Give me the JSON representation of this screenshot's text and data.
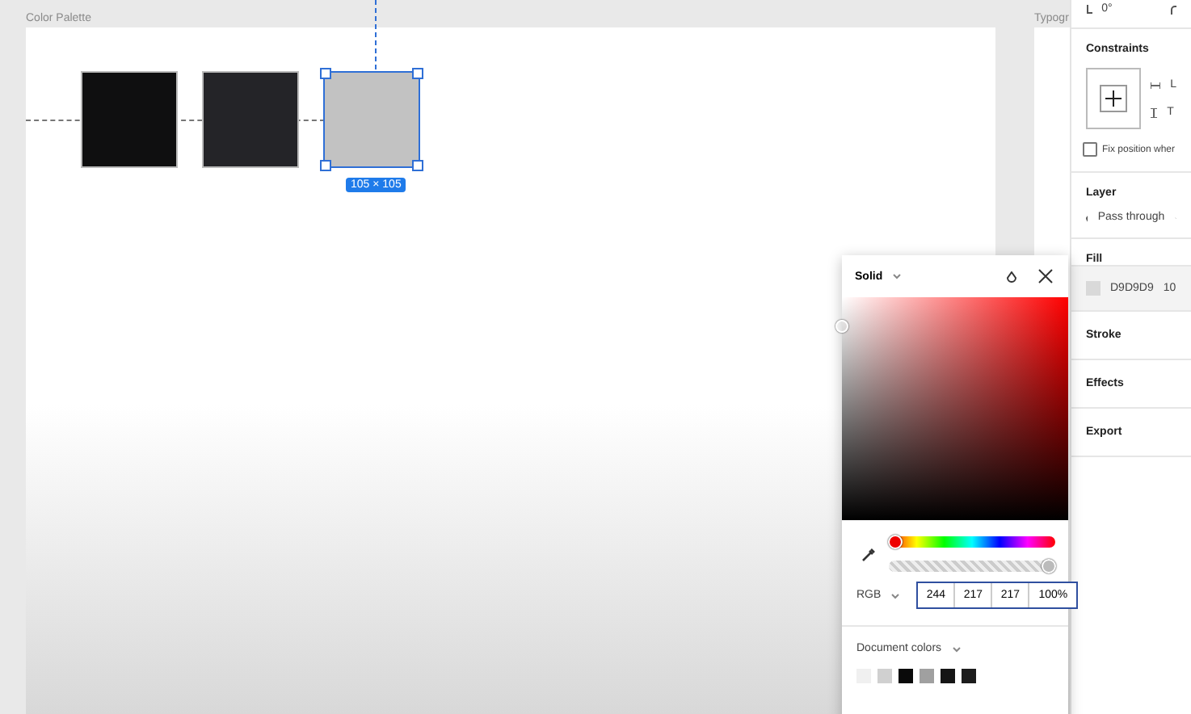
{
  "canvas": {
    "frames": [
      {
        "title": "Color Palette"
      },
      {
        "title": "Typogr"
      }
    ],
    "swatches": [
      {
        "color": "#0f0f10",
        "selected": false
      },
      {
        "color": "#242428",
        "selected": false
      },
      {
        "color": "#c2c2c2",
        "selected": true
      }
    ],
    "size_label": "105 × 105"
  },
  "panel": {
    "rotation": "0°",
    "constraints": {
      "title": "Constraints",
      "horizontal": "L",
      "vertical": "T",
      "fix_label": "Fix position wher",
      "fix_checked": false
    },
    "layer": {
      "title": "Layer",
      "blend": "Pass through"
    },
    "fill": {
      "title": "Fill",
      "hex": "D9D9D9",
      "opacity": "10",
      "color": "#d9d9d9"
    },
    "sections": [
      {
        "title": "Stroke"
      },
      {
        "title": "Effects"
      },
      {
        "title": "Export"
      }
    ]
  },
  "picker": {
    "mode": "Solid",
    "hue": {
      "level": 0.0
    },
    "alpha": {
      "level": 1.0
    },
    "format": "RGB",
    "values": [
      "244",
      "217",
      "217",
      "100%"
    ],
    "document_colors_label": "Document colors",
    "document_colors": [
      {
        "color": "#f0f0f0"
      },
      {
        "color": "#d0d0d0"
      },
      {
        "color": "#0a0a0a"
      },
      {
        "color": "#a0a0a0"
      },
      {
        "color": "#151515"
      },
      {
        "color": "#1c1c1c"
      }
    ]
  }
}
